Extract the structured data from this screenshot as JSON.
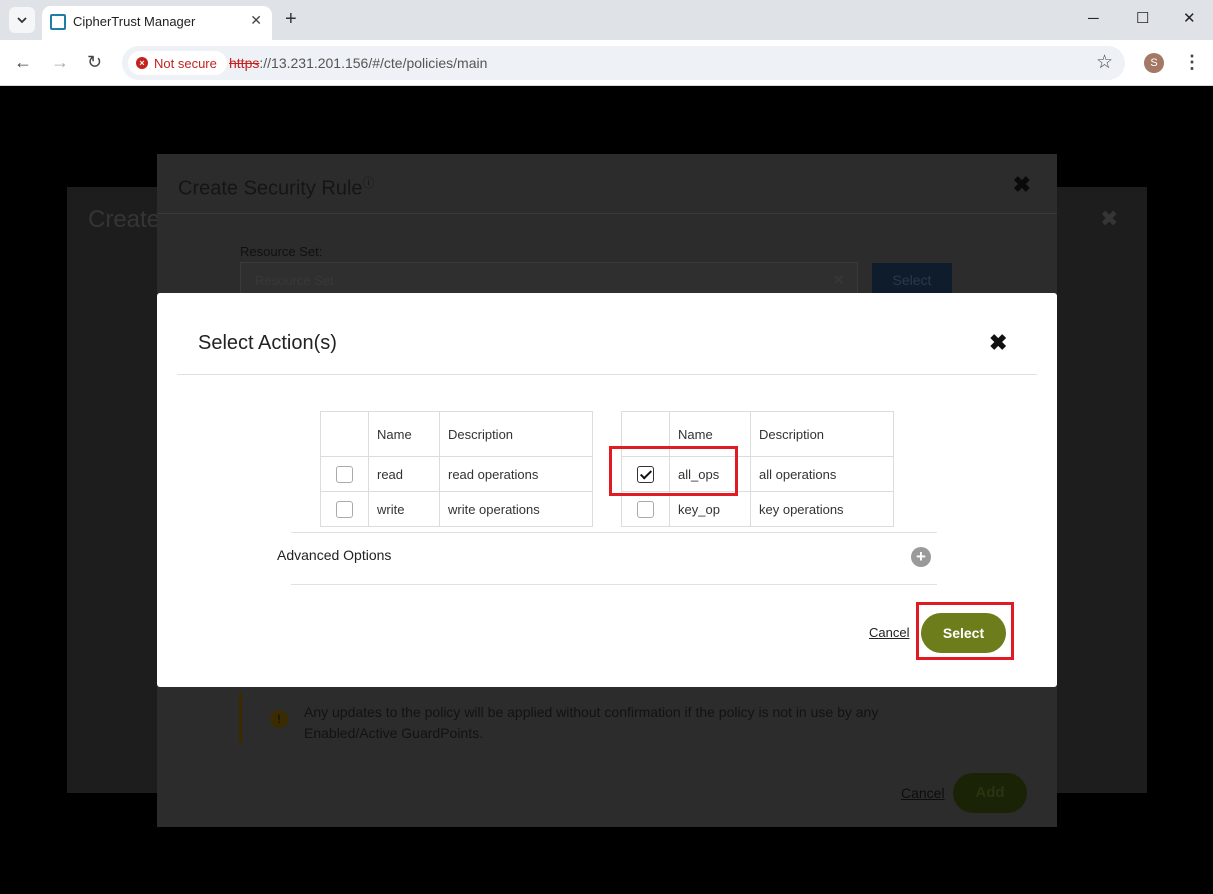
{
  "browser": {
    "tab_title": "CipherTrust Manager",
    "tab_close": "✕",
    "new_tab": "+",
    "security_chip": "Not secure",
    "url_scheme": "https",
    "url_rest": "://13.231.201.156/#/cte/policies/main",
    "profile_initial": "S",
    "icons": [
      "tab-search-icon",
      "back-arrow-icon",
      "forward-arrow-icon",
      "reload-icon",
      "bookmark-star-icon",
      "kebab-menu-icon",
      "minimize-icon",
      "maximize-icon",
      "close-icon"
    ]
  },
  "background": {
    "back_title": "Create",
    "create_rule": {
      "title": "Create Security Rule",
      "resource_set_label": "Resource Set:",
      "resource_set_placeholder": "Resource Set",
      "select_label": "Select",
      "warning_text": "Any updates to the policy will be applied without confirmation if the policy is not in use by any Enabled/Active GuardPoints.",
      "cancel_label": "Cancel",
      "add_label": "Add"
    }
  },
  "dialog": {
    "title": "Select Action(s)",
    "tables": [
      {
        "headers": [
          "Name",
          "Description"
        ],
        "rows": [
          {
            "name": "read",
            "description": "read operations",
            "checked": false
          },
          {
            "name": "write",
            "description": "write operations",
            "checked": false
          }
        ]
      },
      {
        "headers": [
          "Name",
          "Description"
        ],
        "rows": [
          {
            "name": "all_ops",
            "description": "all operations",
            "checked": true
          },
          {
            "name": "key_op",
            "description": "key operations",
            "checked": false
          }
        ]
      }
    ],
    "advanced_options_label": "Advanced Options",
    "cancel_label": "Cancel",
    "select_label": "Select"
  },
  "colors": {
    "select_button": "#6e7d1c",
    "highlight_box": "#e01b24",
    "not_secure": "#c5221f"
  }
}
